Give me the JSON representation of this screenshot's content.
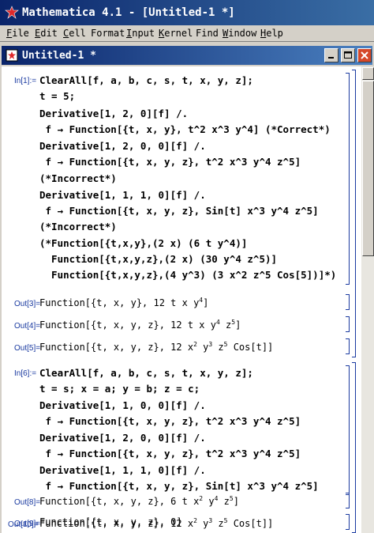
{
  "app": {
    "title": "Mathematica 4.1 - [Untitled-1 *]"
  },
  "menu": [
    {
      "key": "F",
      "rest": "ile"
    },
    {
      "key": "E",
      "rest": "dit"
    },
    {
      "key": "C",
      "rest": "ell"
    },
    {
      "key": "",
      "rest": "Format",
      "under": "o"
    },
    {
      "key": "I",
      "rest": "nput"
    },
    {
      "key": "K",
      "rest": "ernel"
    },
    {
      "key": "",
      "rest": "Find",
      "under": "n"
    },
    {
      "key": "W",
      "rest": "indow"
    },
    {
      "key": "H",
      "rest": "elp"
    }
  ],
  "notebook": {
    "title": "Untitled-1 *"
  },
  "cells": {
    "in1_label": "In[1]:=",
    "in1_lines": [
      "ClearAll[f, a, b, c, s, t, x, y, z];",
      "t = 5;",
      "Derivative[1, 2, 0][f] /.",
      " f → Function[{t, x, y}, t^2 x^3 y^4] (*Correct*)",
      "Derivative[1, 2, 0, 0][f] /.",
      " f → Function[{t, x, y, z}, t^2 x^3 y^4 z^5]",
      "(*Incorrect*)",
      "Derivative[1, 1, 1, 0][f] /.",
      " f → Function[{t, x, y, z}, Sin[t] x^3 y^4 z^5]",
      "(*Incorrect*)",
      "(*Function[{t,x,y},(2 x) (6 t y^4)]",
      "  Function[{t,x,y,z},(2 x) (30 y^4 z^5)]",
      "  Function[{t,x,y,z},(4 y^3) (3 x^2 z^5 Cos[5])]*)"
    ],
    "out3_label": "Out[3]=",
    "out3": {
      "a": "Function[{t, x, y}, 12 t x y",
      "e1": "4",
      "b": "]"
    },
    "out4_label": "Out[4]=",
    "out4": {
      "a": "Function[{t, x, y, z}, 12 t x y",
      "e1": "4",
      "b": " z",
      "e2": "5",
      "c": "]"
    },
    "out5_label": "Out[5]=",
    "out5": {
      "a": "Function[{t, x, y, z}, 12 x",
      "e1": "2",
      "b": " y",
      "e2": "3",
      "c": " z",
      "e3": "5",
      "d": " Cos[t]]"
    },
    "in6_label": "In[6]:=",
    "in6_lines": [
      "ClearAll[f, a, b, c, s, t, x, y, z];",
      "t = s; x = a; y = b; z = c;",
      "Derivative[1, 1, 0, 0][f] /.",
      " f → Function[{t, x, y, z}, t^2 x^3 y^4 z^5]",
      "Derivative[1, 2, 0, 0][f] /.",
      " f → Function[{t, x, y, z}, t^2 x^3 y^4 z^5]",
      "Derivative[1, 1, 1, 0][f] /.",
      " f → Function[{t, x, y, z}, Sin[t] x^3 y^4 z^5]"
    ],
    "out8_label": "Out[8]=",
    "out8": {
      "a": "Function[{t, x, y, z}, 6 t x",
      "e1": "2",
      "b": " y",
      "e2": "4",
      "c": " z",
      "e3": "5",
      "d": "]"
    },
    "out9_label": "Out[9]=",
    "out9": "Function[{t, x, y, z}, 0]",
    "out10_label": "Out[10]=",
    "out10": {
      "a": "Function[{t, x, y, z}, 12 x",
      "e1": "2",
      "b": " y",
      "e2": "3",
      "c": " z",
      "e3": "5",
      "d": " Cos[t]]"
    }
  },
  "colors": {
    "titlebar": "#0a246a",
    "label": "#1a3aa0",
    "close": "#d5482a"
  }
}
